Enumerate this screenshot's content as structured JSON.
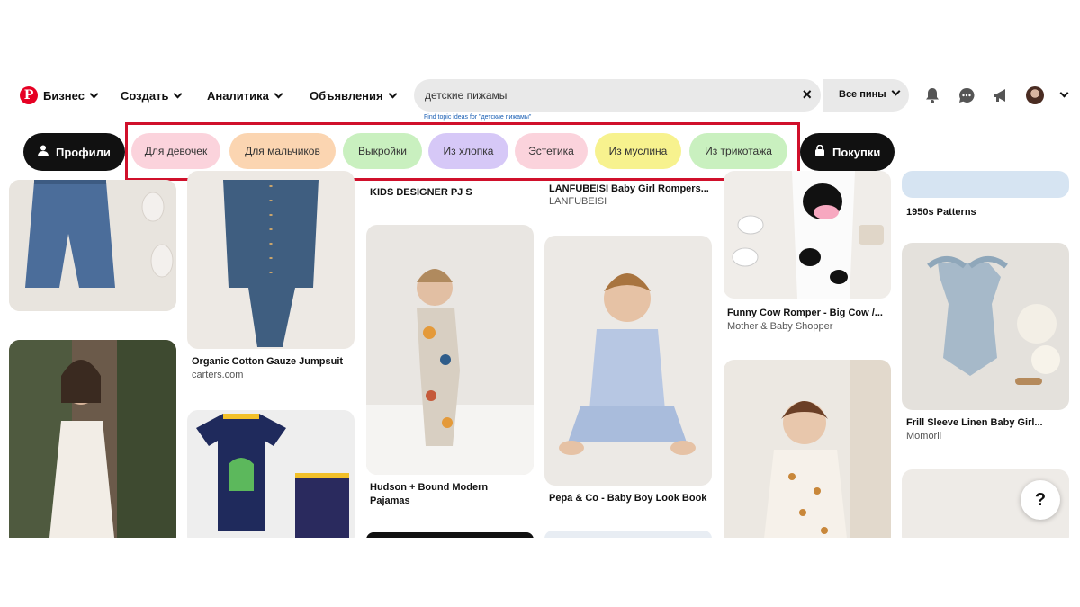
{
  "header": {
    "logo_letter": "P",
    "menu": [
      "Бизнес",
      "Создать",
      "Аналитика",
      "Объявления"
    ],
    "search_value": "детские пижамы",
    "clear_icon": "×",
    "scope_label": "Все пины",
    "topic_hint": "Find topic ideas for \"детские пижамы\"",
    "icons": [
      "bell-icon",
      "chat-icon",
      "megaphone-icon",
      "avatar",
      "chevron-down-icon"
    ]
  },
  "filters": {
    "profiles": "Профили",
    "shopping": "Покупки",
    "chips": [
      {
        "label": "Для девочек",
        "color": "#fbd3dc"
      },
      {
        "label": "Для мальчиков",
        "color": "#fbd5b1"
      },
      {
        "label": "Выкройки",
        "color": "#c9f0bf"
      },
      {
        "label": "Из хлопка",
        "color": "#d6c8f7"
      },
      {
        "label": "Эстетика",
        "color": "#fbd3dc"
      },
      {
        "label": "Из муслина",
        "color": "#f7f28e"
      },
      {
        "label": "Из трикотажа",
        "color": "#c9f0bf"
      }
    ],
    "highlight_color": "#d0102b"
  },
  "pins": {
    "col3_top": "KIDS DESIGNER PJ S",
    "col4_top_title": "LANFUBEISI Baby Girl Rompers...",
    "col4_top_source": "LANFUBEISI",
    "col6_top": "1950s Patterns",
    "jumpsuit_title": "Organic Cotton Gauze Jumpsuit",
    "jumpsuit_source": "carters.com",
    "hudson_line1": "Hudson + Bound Modern",
    "hudson_line2": "Pajamas",
    "pepa_title": "Pepa & Co - Baby Boy Look Book",
    "cow_title": "Funny Cow Romper - Big Cow /...",
    "cow_source": "Mother & Baby Shopper",
    "frill_title": "Frill Sleeve Linen Baby Girl...",
    "frill_source": "Momorii"
  },
  "help_label": "?"
}
